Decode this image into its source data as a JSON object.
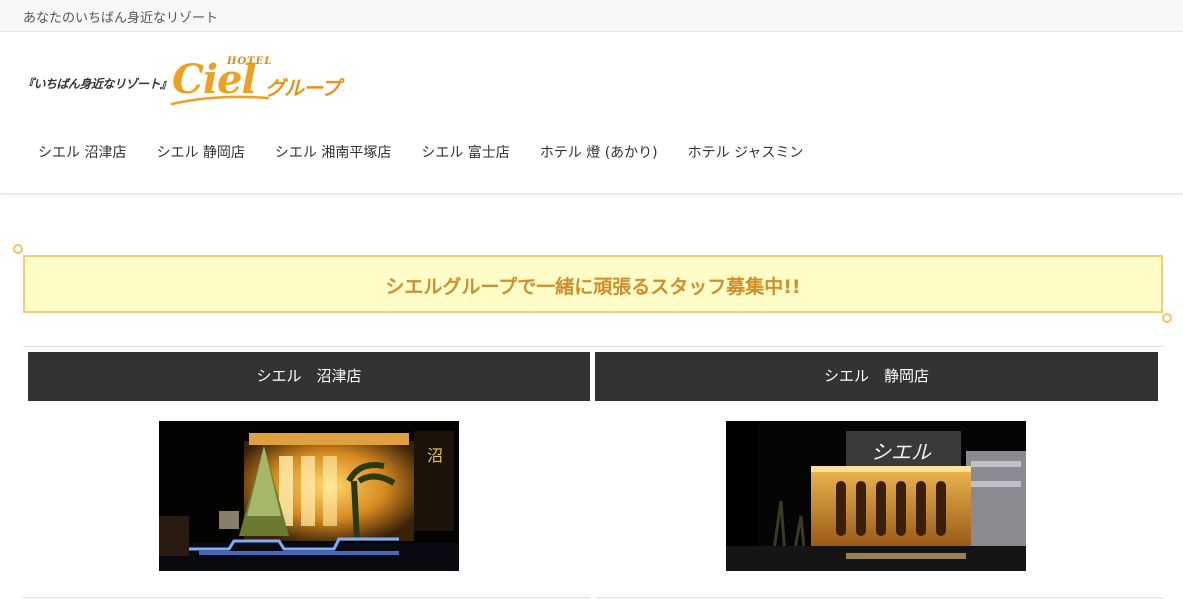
{
  "topbar": {
    "tagline": "あなたのいちばん身近なリゾート"
  },
  "logo": {
    "prefix": "『いちばん身近なリゾート』",
    "hotel": "HOTEL",
    "brand": "Ciel",
    "group": "グループ",
    "accent_color": "#f0a020"
  },
  "nav": {
    "items": [
      {
        "label": "シエル 沼津店"
      },
      {
        "label": "シエル 静岡店"
      },
      {
        "label": "シエル 湘南平塚店"
      },
      {
        "label": "シエル 富士店"
      },
      {
        "label": "ホテル 燈 (あかり)"
      },
      {
        "label": "ホテル ジャスミン"
      }
    ]
  },
  "recruit": {
    "title": "シエルグループで一緒に頑張るスタッフ募集中!!"
  },
  "stores": [
    {
      "name": "シエル　沼津店",
      "photo": "numazu-hotel-photo"
    },
    {
      "name": "シエル　静岡店",
      "photo": "shizuoka-hotel-photo"
    }
  ],
  "colors": {
    "header_bar": "#333333",
    "recruit_bg": "#fffcc8",
    "recruit_border": "#f5cd78",
    "recruit_text": "#cf8f2c"
  }
}
